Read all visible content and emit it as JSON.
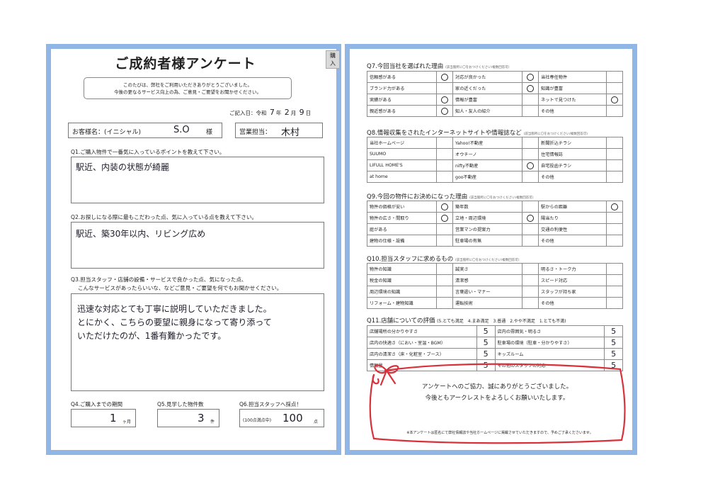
{
  "left": {
    "tag": "購入",
    "title": "ご成約者様アンケート",
    "intro": [
      "このたびは、弊社をご利用いただきありがとうございました。",
      "今後の更なるサービス向上の為、ご意見・ご要望をお聞かせください。"
    ],
    "date_prefix": "ご記入日：令和",
    "date_year": "7",
    "date_year_label": "年",
    "date_month": "2",
    "date_month_label": "月",
    "date_day": "9",
    "date_day_label": "日",
    "customer_label": "お客様名：(イニシャル)",
    "customer_value": "S.O",
    "customer_suffix": "様",
    "staff_label": "営業担当：",
    "staff_value": "木村",
    "q1": "Q1.ご購入物件で一番気に入っているポイントを教えて下さい。",
    "q1_answer": "駅近、内装の状態が綺麗",
    "q2": "Q2.お探しになる際に最もこだわった点、気に入っている点を教えて下さい。",
    "q2_answer": "駅近、築30年以内、リビング広め",
    "q3_line1": "Q3.担当スタッフ・店舗の設備・サービスで良かった点、気になった点、",
    "q3_line2": "こんなサービスがあったらいいな、などご意見・ご要望を何でもお聞かせください。",
    "q3_answer": [
      "迅速な対応とても丁寧に説明していただきました。",
      "とにかく、こちらの要望に親身になって寄り添って",
      "いただけたのが、1番有難かったです。"
    ],
    "q4": "Q4.ご購入までの期間",
    "q4_value": "1",
    "q4_unit": "ヶ月",
    "q5": "Q5.見学した物件数",
    "q5_value": "3",
    "q5_unit": "件",
    "q6": "Q6.担当スタッフへ採点！",
    "q6_hint": "(100点満点中)",
    "q6_value": "100",
    "q6_unit": "点"
  },
  "right": {
    "q7_title": "Q7.今回当社を選ばれた理由",
    "q7_note": "(該当箇所に〇をおつけください/複数回答可)",
    "q7_rows": [
      [
        "信頼感がある",
        true,
        "対応が良かった",
        true,
        "当社専任物件",
        false
      ],
      [
        "ブランド力がある",
        false,
        "家の近くだった",
        true,
        "知識が豊富",
        false
      ],
      [
        "実績がある",
        true,
        "情報が豊富",
        false,
        "ネットで見つけた",
        true
      ],
      [
        "親近感がある",
        true,
        "知人・友人の紹介",
        false,
        "その他",
        false
      ]
    ],
    "q8_title": "Q8.情報収集をされたインターネットサイトや情報誌など",
    "q8_note": "(該当箇所に〇をおつけください/複数回答可)",
    "q8_rows": [
      [
        "当社ホームページ",
        false,
        "Yahoo!不動産",
        false,
        "新聞折込チラシ",
        false
      ],
      [
        "SUUMO",
        false,
        "オウチーノ",
        false,
        "住宅情報誌",
        false
      ],
      [
        "LIFULL HOME'S",
        false,
        "nifty不動産",
        true,
        "自宅投函チラシ",
        false
      ],
      [
        "at home",
        false,
        "goo不動産",
        false,
        "その他",
        false
      ]
    ],
    "q9_title": "Q9.今回の物件にお決めになった理由",
    "q9_note": "(該当箇所に〇をおつけください/複数回答可)",
    "q9_rows": [
      [
        "物件の価格が安い",
        true,
        "築年数",
        false,
        "駅からの距離",
        true
      ],
      [
        "物件の広さ・間取り",
        true,
        "立地・周辺環境",
        true,
        "陽当たり",
        false
      ],
      [
        "庭がある",
        false,
        "営業マンの提案力",
        false,
        "交通の利便性",
        false
      ],
      [
        "建物の仕様・設備",
        false,
        "駐車場の有無",
        false,
        "その他",
        false
      ]
    ],
    "q10_title": "Q10.担当スタッフに求めるもの",
    "q10_note": "(該当箇所に〇をおつけください/複数回答可)",
    "q10_rows": [
      [
        "物件の知識",
        false,
        "誠実さ",
        false,
        "明るさ・トーク力",
        false
      ],
      [
        "税金の知識",
        false,
        "清潔感",
        false,
        "スピード対応",
        false
      ],
      [
        "周辺環境の知識",
        false,
        "言葉遣い・マナー",
        false,
        "スタッフが持ち家",
        false
      ],
      [
        "リフォーム・建物知識",
        false,
        "運転技術",
        false,
        "その他",
        false
      ]
    ],
    "q11_title": "Q11.店舗についての評価",
    "q11_scale": "(5.とても満足　4.まあ満足　3.普通　2.やや不満足　1.とても不満)",
    "q11_rows": [
      [
        "店舗場所の分かりやすさ",
        "5",
        "店内の雰囲気・明るさ",
        "5"
      ],
      [
        "店内の快適さ（におい・室温・BGM）",
        "5",
        "駐車場の環境（駐車・分かりやすさ）",
        "5"
      ],
      [
        "店内の清潔さ（床・化粧室・ブース）",
        "5",
        "キッズルーム",
        "5"
      ],
      [
        "情報量",
        "5",
        "その他のスタッフの対応",
        "5"
      ]
    ],
    "thanks1": "アンケートへのご協力、誠にありがとうございました。",
    "thanks2": "今後ともアークレストをよろしくお願いいたします。",
    "fine_print": "※本アンケートは匿名にて弊社情報誌や当社ホームページに掲載させていただきますので、予めご了承くださいませ。"
  },
  "colors": {
    "frame": "#8fb6e4",
    "ribbon": "#d8313a",
    "ink": "#1c1c28"
  }
}
